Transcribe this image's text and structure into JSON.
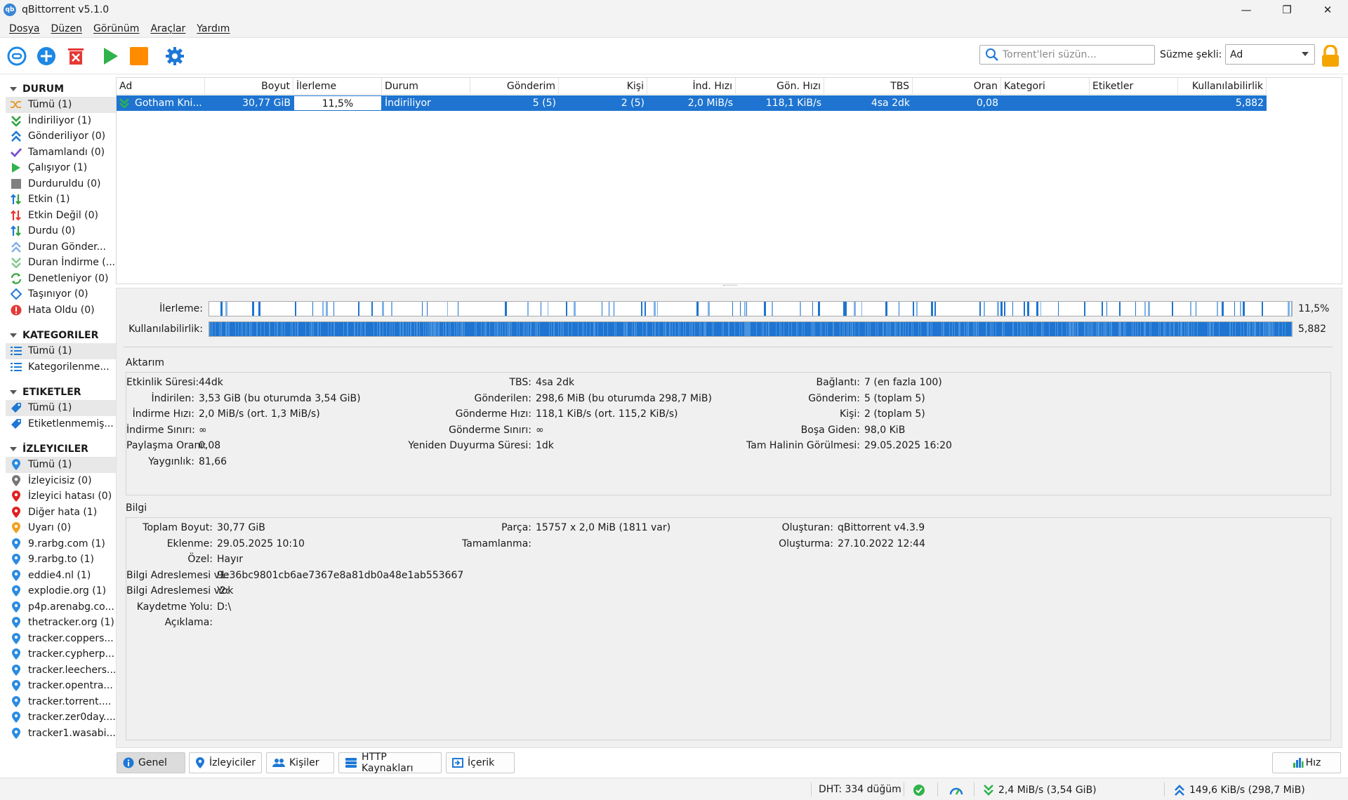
{
  "window": {
    "title": "qBittorrent v5.1.0",
    "icon_text": "qb",
    "min": "—",
    "max": "❐",
    "close": "✕"
  },
  "menu": [
    "Dosya",
    "Düzen",
    "Görünüm",
    "Araçlar",
    "Yardım"
  ],
  "toolbar": {
    "filter_placeholder": "Torrent'leri süzün...",
    "filter_mode_label": "Süzme şekli:",
    "filter_mode_value": "Ad",
    "icons": [
      "add-link-icon",
      "add-torrent-icon",
      "delete-icon",
      "resume-icon",
      "pause-icon",
      "options-icon",
      "lock-icon"
    ]
  },
  "sidebar": {
    "status": {
      "title": "DURUM",
      "items": [
        {
          "label": "Tümü (1)",
          "icon": "all-icon"
        },
        {
          "label": "İndiriliyor (1)",
          "icon": "downloading-icon"
        },
        {
          "label": "Gönderiliyor (0)",
          "icon": "seeding-icon"
        },
        {
          "label": "Tamamlandı (0)",
          "icon": "completed-icon"
        },
        {
          "label": "Çalışıyor (1)",
          "icon": "running-icon"
        },
        {
          "label": "Durduruldu (0)",
          "icon": "stopped-icon"
        },
        {
          "label": "Etkin (1)",
          "icon": "active-icon"
        },
        {
          "label": "Etkin Değil (0)",
          "icon": "inactive-icon"
        },
        {
          "label": "Durdu (0)",
          "icon": "stalled-icon"
        },
        {
          "label": "Duran Gönder...",
          "icon": "stalled-upload-icon"
        },
        {
          "label": "Duran İndirme (...",
          "icon": "stalled-download-icon"
        },
        {
          "label": "Denetleniyor (0)",
          "icon": "checking-icon"
        },
        {
          "label": "Taşınıyor (0)",
          "icon": "moving-icon"
        },
        {
          "label": "Hata Oldu (0)",
          "icon": "error-icon"
        }
      ]
    },
    "categories": {
      "title": "KATEGORILER",
      "items": [
        {
          "label": "Tümü (1)"
        },
        {
          "label": "Kategorilenme..."
        }
      ]
    },
    "tags": {
      "title": "ETIKETLER",
      "items": [
        {
          "label": "Tümü (1)"
        },
        {
          "label": "Etiketlenmemiş..."
        }
      ]
    },
    "trackers": {
      "title": "İZLEYICILER",
      "items": [
        {
          "label": "Tümü (1)",
          "color": "#2b8be0"
        },
        {
          "label": "İzleyicisiz (0)",
          "color": "#777777"
        },
        {
          "label": "İzleyici hatası (0)",
          "color": "#e02020"
        },
        {
          "label": "Diğer hata (1)",
          "color": "#e02020"
        },
        {
          "label": "Uyarı (0)",
          "color": "#f0a020"
        },
        {
          "label": "9.rarbg.com (1)",
          "color": "#2b8be0"
        },
        {
          "label": "9.rarbg.to (1)",
          "color": "#2b8be0"
        },
        {
          "label": "eddie4.nl (1)",
          "color": "#2b8be0"
        },
        {
          "label": "explodie.org (1)",
          "color": "#2b8be0"
        },
        {
          "label": "p4p.arenabg.co...",
          "color": "#2b8be0"
        },
        {
          "label": "thetracker.org (1)",
          "color": "#2b8be0"
        },
        {
          "label": "tracker.coppers...",
          "color": "#2b8be0"
        },
        {
          "label": "tracker.cypherp...",
          "color": "#2b8be0"
        },
        {
          "label": "tracker.leechers...",
          "color": "#2b8be0"
        },
        {
          "label": "tracker.opentra...",
          "color": "#2b8be0"
        },
        {
          "label": "tracker.torrent....",
          "color": "#2b8be0"
        },
        {
          "label": "tracker.zer0day....",
          "color": "#2b8be0"
        },
        {
          "label": "tracker1.wasabi...",
          "color": "#2b8be0"
        }
      ]
    }
  },
  "torrent_list": {
    "columns": [
      "Ad",
      "Boyut",
      "İlerleme",
      "Durum",
      "Gönderim",
      "Kişi",
      "İnd. Hızı",
      "Gön. Hızı",
      "TBS",
      "Oran",
      "Kategori",
      "Etiketler",
      "Kullanılabilirlik"
    ],
    "rows": [
      {
        "name": "Gotham Kni...",
        "size": "30,77 GiB",
        "progress": "11,5%",
        "status": "İndiriliyor",
        "seeds": "5 (5)",
        "peers": "2 (5)",
        "dl": "2,0 MiB/s",
        "ul": "118,1 KiB/s",
        "eta": "4sa 2dk",
        "ratio": "0,08",
        "category": "",
        "tags": "",
        "availability": "5,882"
      }
    ]
  },
  "details": {
    "progress_label": "İlerleme:",
    "progress_value": "11,5%",
    "progress_fraction": 0.115,
    "availability_label": "Kullanılabilirlik:",
    "availability_value": "5,882",
    "transfer_title": "Aktarım",
    "transfer": {
      "col1": [
        [
          "Etkinlik Süresi:",
          "44dk"
        ],
        [
          "İndirilen:",
          "3,53 GiB (bu oturumda 3,54 GiB)"
        ],
        [
          "İndirme Hızı:",
          "2,0 MiB/s (ort. 1,3 MiB/s)"
        ],
        [
          "İndirme Sınırı:",
          "∞"
        ],
        [
          "Paylaşma Oranı:",
          "0,08"
        ],
        [
          "Yaygınlık:",
          "81,66"
        ]
      ],
      "col2": [
        [
          "TBS:",
          "4sa 2dk"
        ],
        [
          "Gönderilen:",
          "298,6 MiB (bu oturumda 298,7 MiB)"
        ],
        [
          "Gönderme Hızı:",
          "118,1 KiB/s (ort. 115,2 KiB/s)"
        ],
        [
          "Gönderme Sınırı:",
          "∞"
        ],
        [
          "Yeniden Duyurma Süresi:",
          "1dk"
        ]
      ],
      "col3": [
        [
          "Bağlantı:",
          "7 (en fazla 100)"
        ],
        [
          "Gönderim:",
          "5 (toplam 5)"
        ],
        [
          "Kişi:",
          "2 (toplam 5)"
        ],
        [
          "Boşa Giden:",
          "98,0 KiB"
        ],
        [
          "Tam Halinin Görülmesi:",
          "29.05.2025 16:20"
        ]
      ]
    },
    "info_title": "Bilgi",
    "info": {
      "col1": [
        [
          "Toplam Boyut:",
          "30,77 GiB"
        ],
        [
          "Eklenme:",
          "29.05.2025 10:10"
        ],
        [
          "Özel:",
          "Hayır"
        ],
        [
          "Bilgi Adreslemesi v1:",
          "9e36bc9801cb6ae7367e8a81db0a48e1ab553667"
        ],
        [
          "Bilgi Adreslemesi v2:",
          "Yok"
        ],
        [
          "Kaydetme Yolu:",
          "D:\\"
        ],
        [
          "Açıklama:",
          ""
        ]
      ],
      "col2": [
        [
          "Parça:",
          "15757 x 2,0 MiB (1811 var)"
        ],
        [
          "Tamamlanma:",
          ""
        ]
      ],
      "col3": [
        [
          "Oluşturan:",
          "qBittorrent v4.3.9"
        ],
        [
          "Oluşturma:",
          "27.10.2022 12:44"
        ]
      ]
    }
  },
  "tabs": [
    {
      "label": "Genel",
      "icon": "info-icon"
    },
    {
      "label": "İzleyiciler",
      "icon": "tracker-icon"
    },
    {
      "label": "Kişiler",
      "icon": "peers-icon"
    },
    {
      "label": "HTTP Kaynakları",
      "icon": "http-sources-icon"
    },
    {
      "label": "İçerik",
      "icon": "content-icon"
    }
  ],
  "speed_tab": "Hız",
  "statusbar": {
    "dht": "DHT: 334 düğüm",
    "download": "2,4 MiB/s (3,54 GiB)",
    "upload": "149,6 KiB/s (298,7 MiB)"
  }
}
